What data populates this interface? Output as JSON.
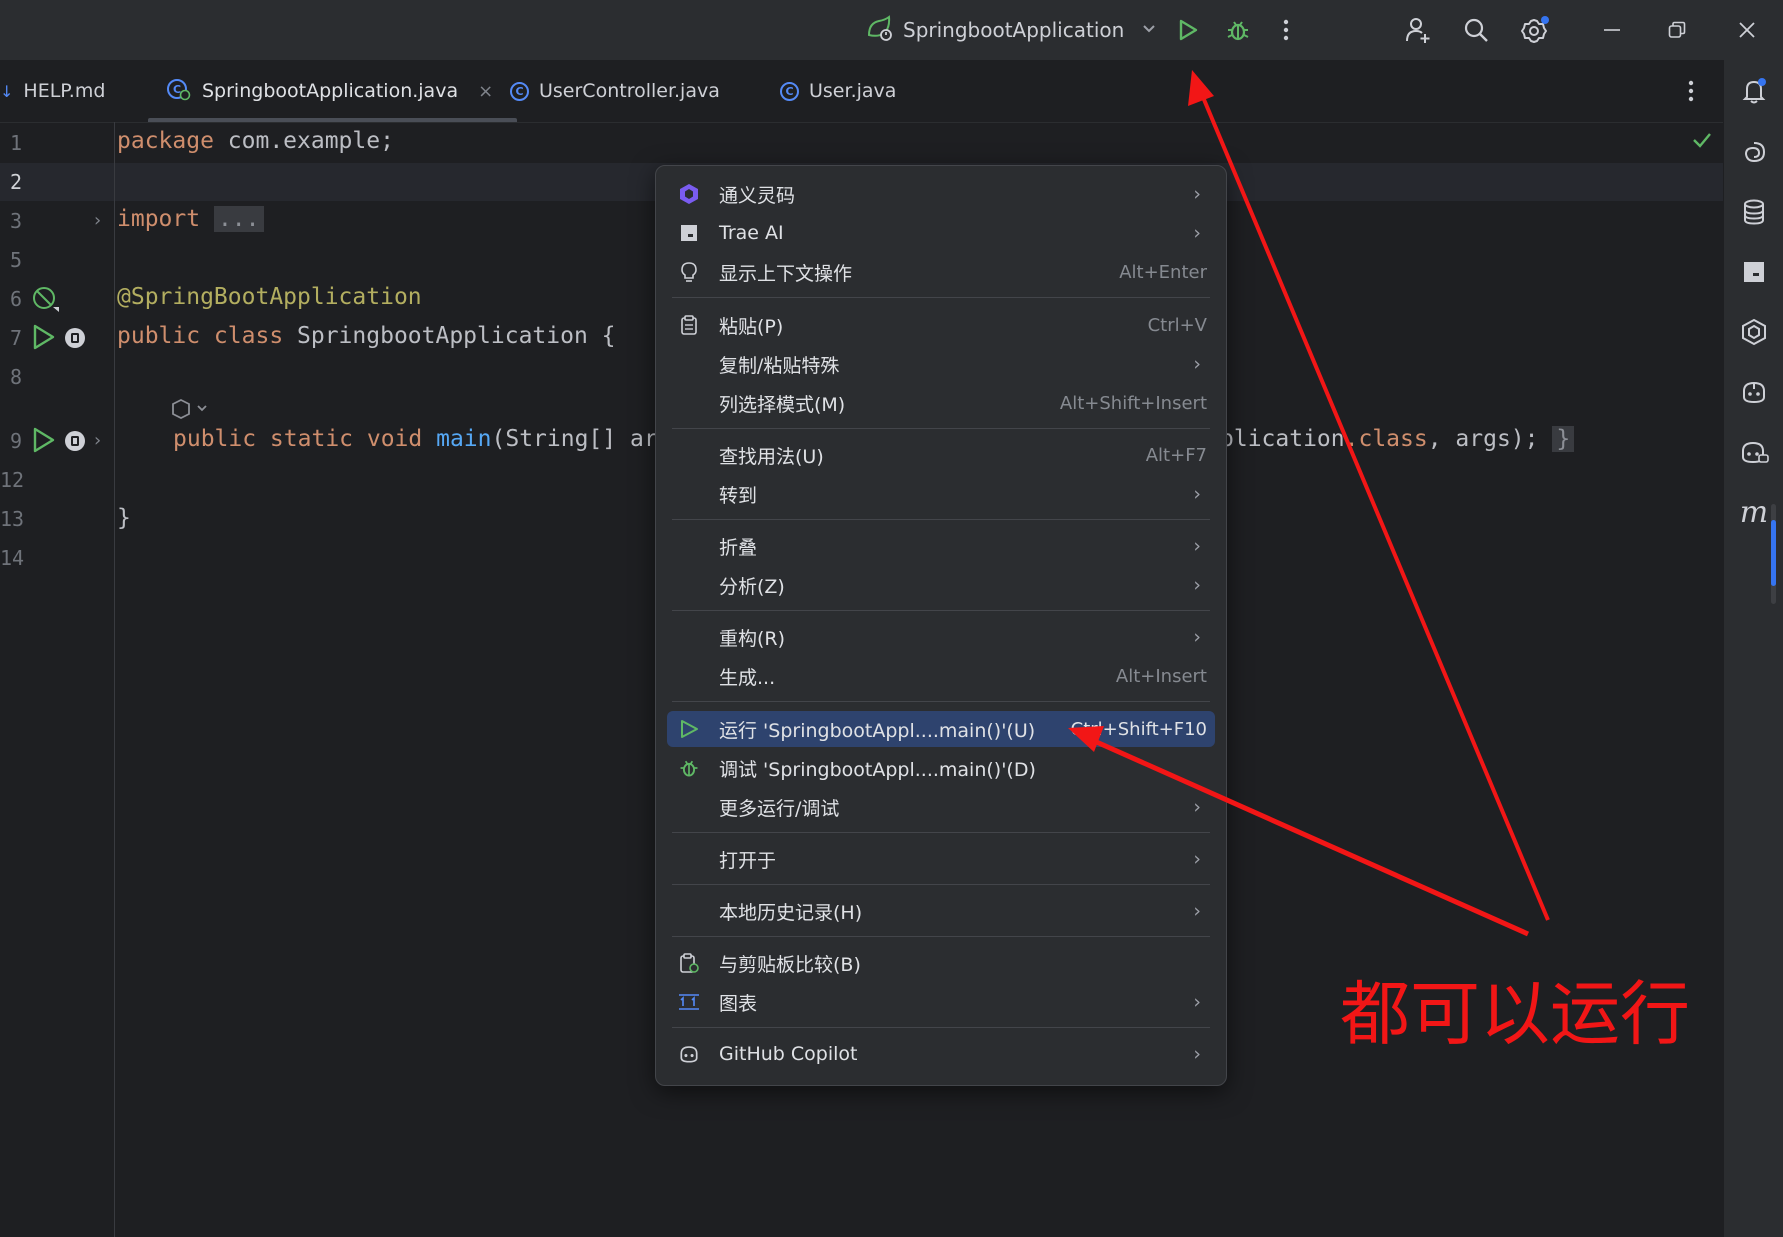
{
  "titlebar": {
    "run_config": "SpringbootApplication",
    "icons": [
      "run-config-icon",
      "chevron-down-icon",
      "run-icon",
      "debug-icon",
      "more-vertical-icon",
      "add-user-icon",
      "search-icon",
      "settings-icon",
      "minimize-icon",
      "restore-icon",
      "close-icon"
    ]
  },
  "tabs": [
    {
      "label": "HELP.md",
      "icon": "markdown-icon"
    },
    {
      "label": "SpringbootApplication.java",
      "icon": "spring-class-icon",
      "active": true
    },
    {
      "label": "UserController.java",
      "icon": "class-icon"
    },
    {
      "label": "User.java",
      "icon": "class-icon"
    }
  ],
  "editor": {
    "line_numbers": [
      "1",
      "2",
      "3",
      "5",
      "6",
      "7",
      "8",
      "9",
      "12",
      "13",
      "14"
    ],
    "current_line": "2",
    "code": {
      "l1_kw": "package",
      "l1_rest": " com.example;",
      "l3_kw": "import",
      "l3_fold": "...",
      "l6_ann": "@SpringBootApplication",
      "l7_kw": "public class",
      "l7_rest": " SpringbootApplication {",
      "l9_kw": "public static void",
      "l9_fn": "main",
      "l9_rest": "(String[] ar",
      "l9_tail_a": "plication",
      "l9_tail_b": ".class",
      "l9_tail_c": ", args);",
      "l9_fold": "}",
      "l13": "}"
    }
  },
  "context_menu": {
    "items": [
      {
        "label": "通义灵码",
        "icon": "tongyi-icon",
        "submenu": true
      },
      {
        "label": "Trae AI",
        "icon": "trae-icon",
        "submenu": true
      },
      {
        "label": "显示上下文操作",
        "icon": "bulb-icon",
        "shortcut": "Alt+Enter"
      },
      {
        "label": "粘贴(P)",
        "icon": "paste-icon",
        "shortcut": "Ctrl+V"
      },
      {
        "label": "复制/粘贴特殊",
        "submenu": true
      },
      {
        "label": "列选择模式(M)",
        "shortcut": "Alt+Shift+Insert"
      },
      {
        "label": "查找用法(U)",
        "shortcut": "Alt+F7"
      },
      {
        "label": "转到",
        "submenu": true
      },
      {
        "label": "折叠",
        "submenu": true
      },
      {
        "label": "分析(Z)",
        "submenu": true
      },
      {
        "label": "重构(R)",
        "submenu": true
      },
      {
        "label": "生成...",
        "shortcut": "Alt+Insert"
      },
      {
        "label": "运行 'SpringbootAppl....main()'(U)",
        "icon": "run-icon",
        "shortcut": "Ctrl+Shift+F10",
        "selected": true
      },
      {
        "label": "调试 'SpringbootAppl....main()'(D)",
        "icon": "debug-icon"
      },
      {
        "label": "更多运行/调试",
        "submenu": true
      },
      {
        "label": "打开于",
        "submenu": true
      },
      {
        "label": "本地历史记录(H)",
        "submenu": true
      },
      {
        "label": "与剪贴板比较(B)",
        "icon": "compare-clipboard-icon"
      },
      {
        "label": "图表",
        "icon": "diagram-icon",
        "submenu": true
      },
      {
        "label": "GitHub Copilot",
        "icon": "copilot-icon",
        "submenu": true
      }
    ]
  },
  "annotation": {
    "text": "都可以运行",
    "color": "#f21616"
  },
  "colors": {
    "background": "#1e1f22",
    "panel": "#2b2d30",
    "selection": "#2e436e",
    "keyword": "#cf8e6d",
    "annotation_code": "#b3ae60",
    "function": "#56a8f5",
    "run_green": "#5fb865"
  }
}
